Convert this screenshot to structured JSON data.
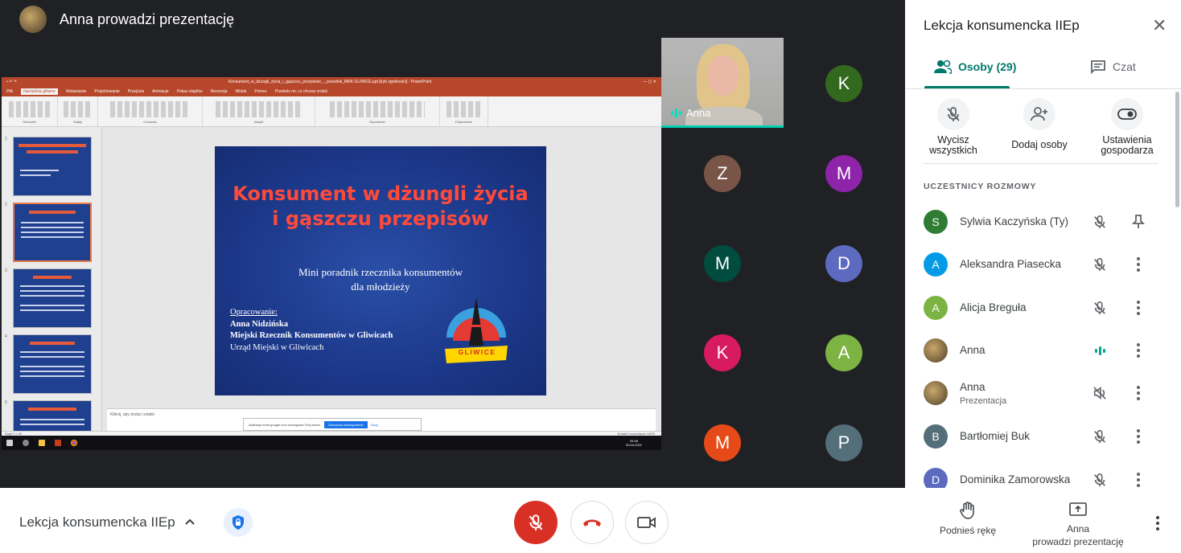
{
  "presenter_bar": {
    "title": "Anna prowadzi prezentację"
  },
  "powerpoint": {
    "window_title": "Konsument_w_dżungli_życia_i_gąszczu_przepisów_-_poradnik_MRK GLIWICE.ppt [tryb zgodności] - PowerPoint",
    "menu": [
      "Plik",
      "Narzędzia główne",
      "Wstawianie",
      "Projektowanie",
      "Przejścia",
      "Animacje",
      "Pokaz slajdów",
      "Recenzja",
      "Widok",
      "Pomoc",
      "Powiedz mi, co chcesz zrobić"
    ],
    "ribbon_groups": [
      "Schowek",
      "Slajdy",
      "Czcionka",
      "Akapit",
      "Rysowanie",
      "Edytowanie"
    ],
    "slide": {
      "title": "Konsument w dżungli życia\ni gąszczu przepisów",
      "subtitle": "Mini poradnik rzecznika konsumentów\ndla młodzieży",
      "credits_label": "Opracowanie:",
      "author": "Anna Nidzińska",
      "role": "Miejski Rzecznik Konsumentów w Gliwicach",
      "office": "Urząd Miejski w Gliwicach",
      "logo_text": "GLIWICE"
    },
    "notes_placeholder": "Kliknij, aby dodać notatki",
    "status_left": "Slajd 2 z 49",
    "status_right": "Notatki   Komentarze   100%",
    "notification": {
      "text": "Aplikacja meet.google.com udostępnia Twój ekran.",
      "stop": "Zatrzymaj udostępnianie",
      "hide": "Ukryj"
    },
    "clock": {
      "time": "09:46",
      "date": "20.04.2021"
    },
    "thumb_numbers": [
      "1",
      "2",
      "3",
      "4",
      "5"
    ]
  },
  "tiles": {
    "anna_label": "Anna",
    "avatars": [
      {
        "letter": "K",
        "color": "#33691e"
      },
      {
        "letter": "Z",
        "color": "#795548"
      },
      {
        "letter": "M",
        "color": "#8e24aa"
      },
      {
        "letter": "M",
        "color": "#004d40"
      },
      {
        "letter": "D",
        "color": "#5c6bc0"
      },
      {
        "letter": "K",
        "color": "#d81b60"
      },
      {
        "letter": "A",
        "color": "#7cb342"
      },
      {
        "letter": "M",
        "color": "#e64a19"
      },
      {
        "letter": "P",
        "color": "#546e7a"
      }
    ]
  },
  "panel": {
    "title": "Lekcja konsumencka IIEp",
    "tab_people": "Osoby (29)",
    "tab_chat": "Czat",
    "action_mute_all": "Wycisz\nwszystkich",
    "action_add": "Dodaj osoby",
    "action_host": "Ustawienia\ngospodarza",
    "section_label": "UCZESTNICY ROZMOWY",
    "participants": [
      {
        "initial": "S",
        "name": "Sylwia Kaczyńska (Ty)",
        "color": "#2e7d32"
      },
      {
        "initial": "A",
        "name": "Aleksandra Piasecka",
        "color": "#039be5"
      },
      {
        "initial": "A",
        "name": "Alicja Breguła",
        "color": "#7cb342"
      },
      {
        "initial": "",
        "name": "Anna",
        "color": ""
      },
      {
        "initial": "",
        "name": "Anna",
        "sub": "Prezentacja",
        "color": ""
      },
      {
        "initial": "B",
        "name": "Bartłomiej Buk",
        "color": "#546e7a"
      },
      {
        "initial": "D",
        "name": "Dominika Zamorowska",
        "color": "#5c6bc0"
      }
    ]
  },
  "bottom": {
    "meeting_name": "Lekcja konsumencka IIEp",
    "raise_hand": "Podnieś rękę",
    "presenting": "Anna\nprowadzi prezentację"
  },
  "colors": {
    "accent": "#00796b",
    "danger": "#d93025",
    "speaking": "#00d1b2"
  }
}
